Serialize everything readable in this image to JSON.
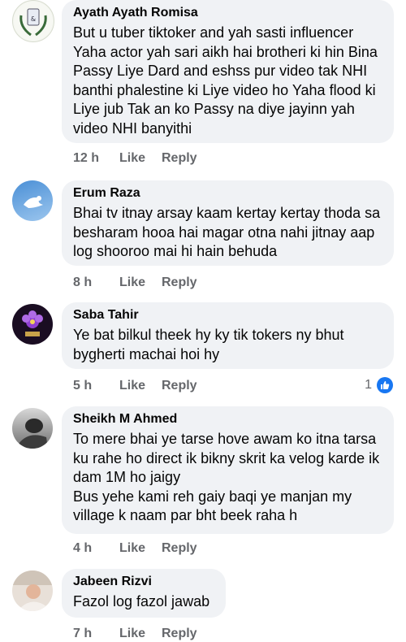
{
  "comments": [
    {
      "author": "Ayath Ayath Romisa",
      "text": "But u tuber tiktoker and yah sasti influencer Yaha actor yah sari aikh hai brotheri ki hin Bina Passy Liye Dard and eshss pur video tak NHI banthi phalestine ki Liye video ho Yaha flood ki Liye jub Tak an ko Passy na diye jayinn yah video NHI banyithi",
      "time": "12 h",
      "like_label": "Like",
      "reply_label": "Reply"
    },
    {
      "author": "Erum Raza",
      "text": "Bhai tv itnay arsay kaam kertay kertay thoda sa besharam hooa hai magar otna nahi jitnay aap log shooroo mai hi hain behuda",
      "time": "8 h",
      "like_label": "Like",
      "reply_label": "Reply"
    },
    {
      "author": "Saba Tahir",
      "text": "Ye bat bilkul theek hy ky tik tokers ny bhut bygherti machai hoi hy",
      "time": "5 h",
      "like_label": "Like",
      "reply_label": "Reply",
      "reaction_count": "1"
    },
    {
      "author": "Sheikh M Ahmed",
      "text": "To mere bhai ye tarse hove awam ko itna tarsa ku rahe ho direct ik bikny skrit ka velog karde ik dam 1M ho jaigy\nBus yehe kami reh gaiy baqi ye manjan my village k naam par bht beek raha h",
      "time": "4 h",
      "like_label": "Like",
      "reply_label": "Reply"
    },
    {
      "author": "Jabeen Rizvi",
      "text": "Fazol log fazol jawab",
      "time": "7 h",
      "like_label": "Like",
      "reply_label": "Reply"
    }
  ],
  "colors": {
    "bubble": "#f0f2f5",
    "meta": "#65676b",
    "like_blue": "#1877f2"
  }
}
